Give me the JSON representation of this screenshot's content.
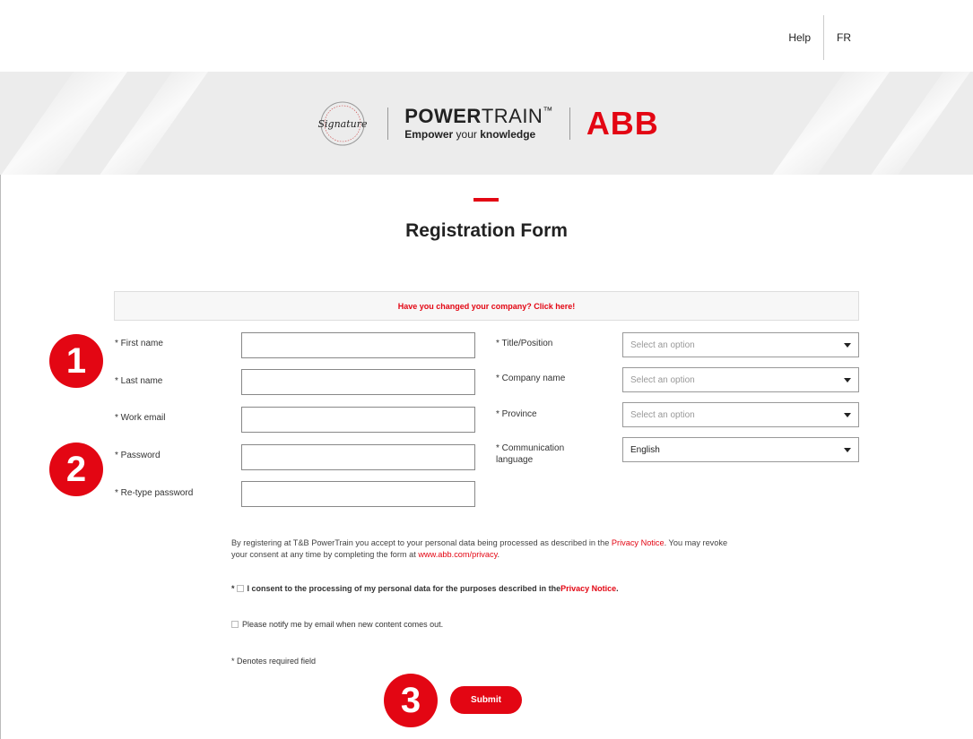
{
  "topnav": {
    "help": "Help",
    "lang": "FR"
  },
  "logos": {
    "signature_text": "Signature",
    "powertrain_bold": "POWER",
    "powertrain_light": "TRAIN",
    "powertrain_tm": "™",
    "tagline_1": "Empower",
    "tagline_2": " your ",
    "tagline_3": "knowledge",
    "abb": "ABB"
  },
  "page": {
    "title": "Registration Form"
  },
  "notice": {
    "text": "Have you changed your company? Click here!"
  },
  "left_fields": [
    {
      "label": "* First name",
      "value": ""
    },
    {
      "label": "* Last name",
      "value": ""
    },
    {
      "label": "* Work email",
      "value": ""
    },
    {
      "label": "* Password",
      "value": ""
    },
    {
      "label": "* Re-type password",
      "value": ""
    }
  ],
  "right_fields": [
    {
      "label": "* Title/Position",
      "value": "Select an option"
    },
    {
      "label": "* Company name",
      "value": "Select an option"
    },
    {
      "label": "* Province",
      "value": "Select an option"
    },
    {
      "label_line1": "* Communication",
      "label_line2": "language",
      "value": "English"
    }
  ],
  "badges": [
    "1",
    "2",
    "3"
  ],
  "consent": {
    "para_1": "By registering at T&B PowerTrain you accept to your personal data being processed as described in the ",
    "privacy_link_1": "Privacy Notice",
    "para_2": ". You may revoke your consent at any time by completing the form at ",
    "abb_privacy_link": "www.abb.com/privacy",
    "para_3": ".",
    "check1_prefix": "* ",
    "check1_text": "I consent to the processing of my personal data for the purposes described in the ",
    "privacy_link_2": "Privacy Notice",
    "check1_suffix": ".",
    "check2_text": "Please notify me by email when new content comes out."
  },
  "required_note": "* Denotes required field",
  "submit_label": "Submit",
  "colors": {
    "accent": "#e30613",
    "hero_bg": "#ececec"
  }
}
